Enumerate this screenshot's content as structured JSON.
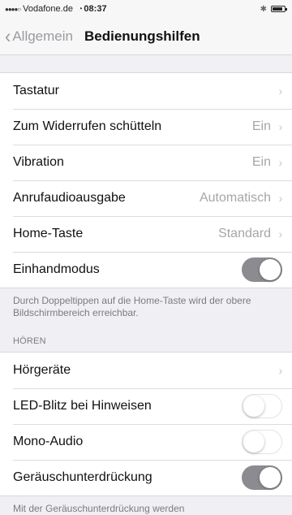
{
  "status_bar": {
    "carrier": "Vodafone.de",
    "time": "08:37"
  },
  "nav": {
    "back_label": "Allgemein",
    "title": "Bedienungshilfen"
  },
  "group1": {
    "rows": [
      {
        "label": "Tastatur",
        "value": ""
      },
      {
        "label": "Zum Widerrufen schütteln",
        "value": "Ein"
      },
      {
        "label": "Vibration",
        "value": "Ein"
      },
      {
        "label": "Anrufaudioausgabe",
        "value": "Automatisch"
      },
      {
        "label": "Home-Taste",
        "value": "Standard"
      },
      {
        "label": "Einhandmodus",
        "toggle": true
      }
    ],
    "footer": "Durch Doppeltippen auf die Home-Taste wird der obere Bildschirmbereich erreichbar."
  },
  "hearing": {
    "header": "HÖREN",
    "rows": [
      {
        "label": "Hörgeräte"
      },
      {
        "label": "LED-Blitz bei Hinweisen",
        "toggle": false
      },
      {
        "label": "Mono-Audio",
        "toggle": false
      },
      {
        "label": "Geräuschunterdrückung",
        "toggle": true
      }
    ],
    "footer": "Mit der Geräuschunterdrückung werden Umgebungsgeräusche bei Telefonaten unterdrückt,"
  },
  "colors": {
    "toggle_on": "#8b8b90",
    "toggle_off": "#ffffff",
    "background": "#efeff4"
  }
}
